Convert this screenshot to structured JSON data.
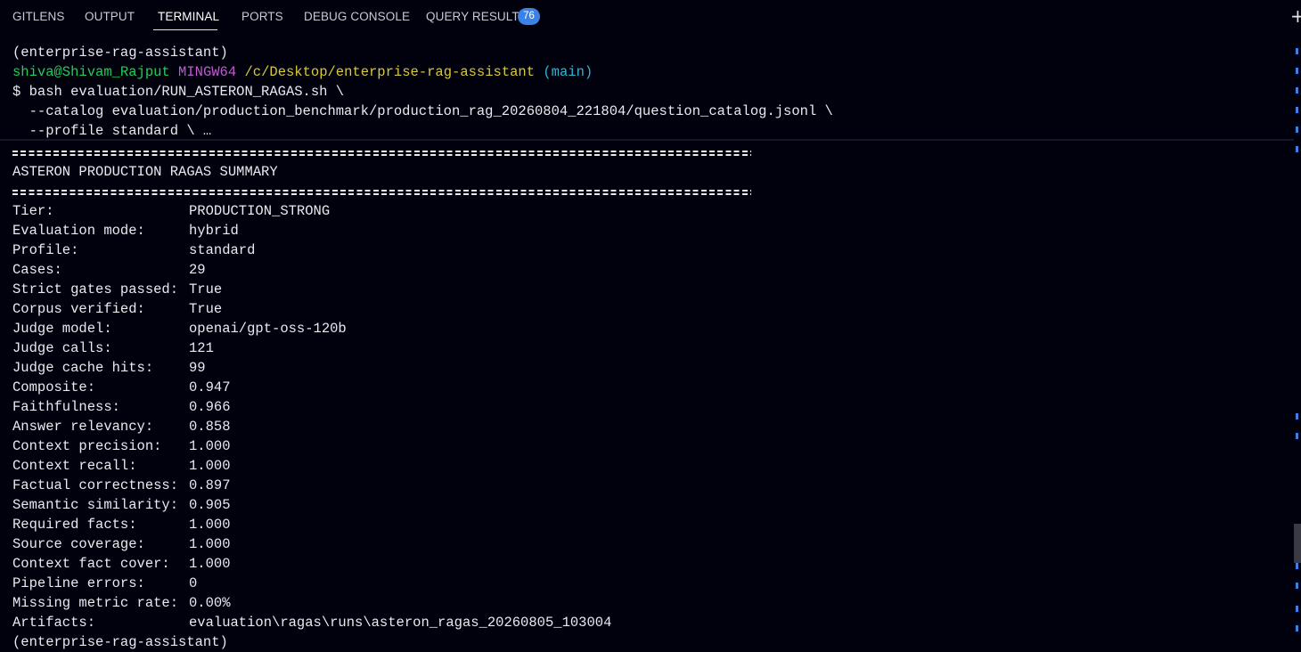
{
  "panel": {
    "tabs": [
      {
        "label": "GITLENS"
      },
      {
        "label": "OUTPUT"
      },
      {
        "label": "TERMINAL"
      },
      {
        "label": "PORTS"
      },
      {
        "label": "DEBUG CONSOLE"
      },
      {
        "label": "QUERY RESULTS"
      }
    ],
    "active_tab": "TERMINAL",
    "query_results_badge": "76",
    "new_terminal_icon": "plus-icon"
  },
  "terminal": {
    "env_line_1": "(enterprise-rag-assistant)",
    "prompt": {
      "user_host": "shiva@Shivam_Rajput",
      "shell": "MINGW64",
      "path": "/c/Desktop/enterprise-rag-assistant",
      "branch": "(main)"
    },
    "command_lines": [
      "$ bash evaluation/RUN_ASTERON_RAGAS.sh \\",
      "  --catalog evaluation/production_benchmark/production_rag_20260804_221804/question_catalog.jsonl \\",
      "  --profile standard \\ …"
    ],
    "summary_title": "ASTERON PRODUCTION RAGAS SUMMARY",
    "summary_rows": [
      {
        "key": "Tier:",
        "value": "PRODUCTION_STRONG"
      },
      {
        "key": "Evaluation mode:",
        "value": "hybrid"
      },
      {
        "key": "Profile:",
        "value": "standard"
      },
      {
        "key": "Cases:",
        "value": "29"
      },
      {
        "key": "Strict gates passed:",
        "value": "True"
      },
      {
        "key": "Corpus verified:",
        "value": "True"
      },
      {
        "key": "Judge model:",
        "value": "openai/gpt-oss-120b"
      },
      {
        "key": "Judge calls:",
        "value": "121"
      },
      {
        "key": "Judge cache hits:",
        "value": "99"
      },
      {
        "key": "Composite:",
        "value": "0.947"
      },
      {
        "key": "Faithfulness:",
        "value": "0.966"
      },
      {
        "key": "Answer relevancy:",
        "value": "0.858"
      },
      {
        "key": "Context precision:",
        "value": "1.000"
      },
      {
        "key": "Context recall:",
        "value": "1.000"
      },
      {
        "key": "Factual correctness:",
        "value": "0.897"
      },
      {
        "key": "Semantic similarity:",
        "value": "0.905"
      },
      {
        "key": "Required facts:",
        "value": "1.000"
      },
      {
        "key": "Source coverage:",
        "value": "1.000"
      },
      {
        "key": "Context fact cover:",
        "value": "1.000"
      },
      {
        "key": "Pipeline errors:",
        "value": "0"
      },
      {
        "key": "Missing metric rate:",
        "value": "0.00%"
      },
      {
        "key": "Artifacts:",
        "value": "evaluation\\ragas\\runs\\asteron_ragas_20260805_103004"
      }
    ],
    "env_line_2": "(enterprise-rag-assistant)"
  }
}
